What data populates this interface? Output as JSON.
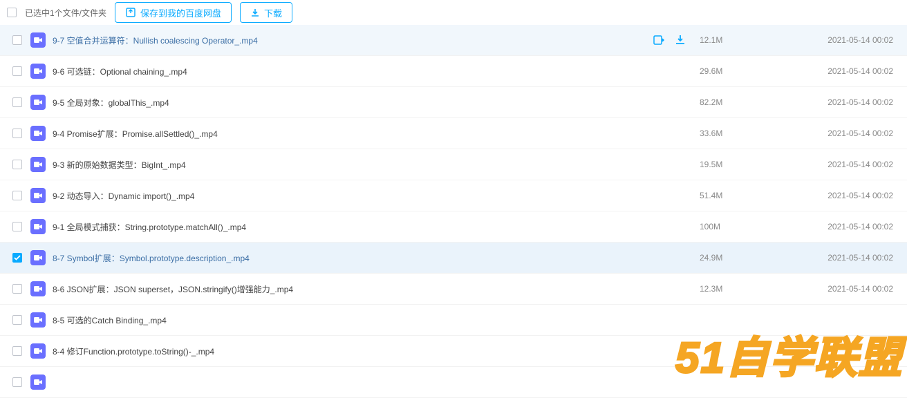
{
  "toolbar": {
    "selected_text": "已选中1个文件/文件夹",
    "save_label": "保存到我的百度网盘",
    "download_label": "下载"
  },
  "files": [
    {
      "name": "9-7 空值合并运算符：Nullish coalescing Operator_.mp4",
      "size": "12.1M",
      "date": "2021-05-14 00:02",
      "state": "hover"
    },
    {
      "name": "9-6 可选链：Optional chaining_.mp4",
      "size": "29.6M",
      "date": "2021-05-14 00:02",
      "state": ""
    },
    {
      "name": "9-5 全局对象：globalThis_.mp4",
      "size": "82.2M",
      "date": "2021-05-14 00:02",
      "state": ""
    },
    {
      "name": "9-4 Promise扩展：Promise.allSettled()_.mp4",
      "size": "33.6M",
      "date": "2021-05-14 00:02",
      "state": ""
    },
    {
      "name": "9-3 新的原始数据类型：BigInt_.mp4",
      "size": "19.5M",
      "date": "2021-05-14 00:02",
      "state": ""
    },
    {
      "name": "9-2 动态导入：Dynamic import()_.mp4",
      "size": "51.4M",
      "date": "2021-05-14 00:02",
      "state": ""
    },
    {
      "name": "9-1 全局模式捕获：String.prototype.matchAll()_.mp4",
      "size": "100M",
      "date": "2021-05-14 00:02",
      "state": ""
    },
    {
      "name": "8-7 Symbol扩展：Symbol.prototype.description_.mp4",
      "size": "24.9M",
      "date": "2021-05-14 00:02",
      "state": "selected"
    },
    {
      "name": "8-6 JSON扩展：JSON superset，JSON.stringify()增强能力_.mp4",
      "size": "12.3M",
      "date": "2021-05-14 00:02",
      "state": ""
    },
    {
      "name": "8-5 可选的Catch Binding_.mp4",
      "size": "",
      "date": "",
      "state": ""
    },
    {
      "name": "8-4 修订Function.prototype.toString()-_.mp4",
      "size": "",
      "date": "",
      "state": ""
    },
    {
      "name": "",
      "size": "",
      "date": "",
      "state": ""
    }
  ],
  "watermark": "51自学联盟"
}
